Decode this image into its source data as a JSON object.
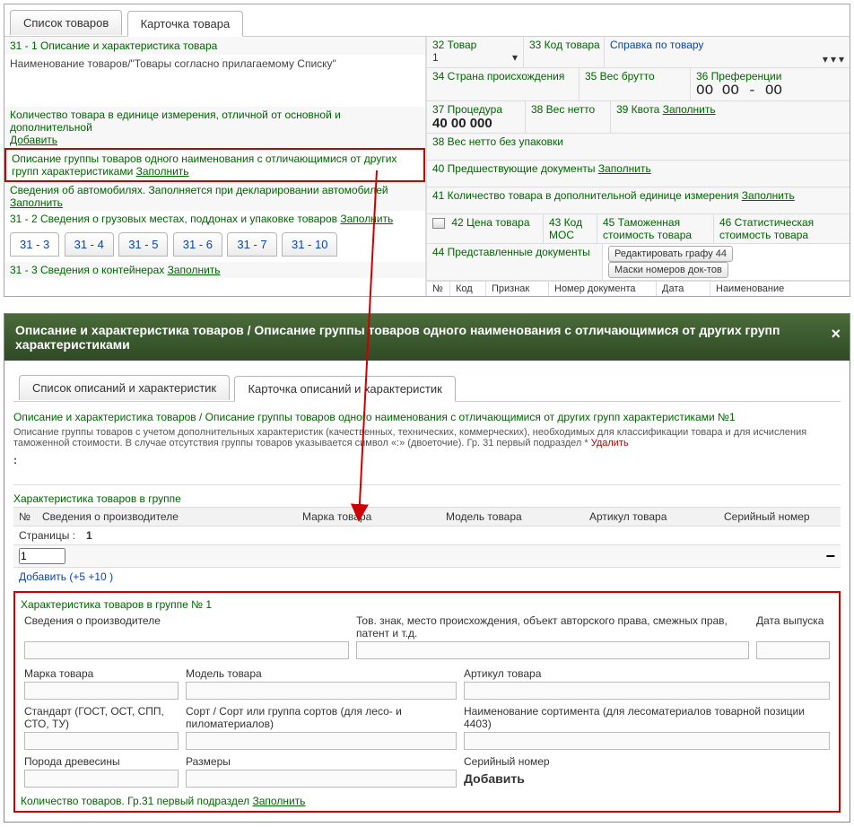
{
  "top": {
    "tabs": {
      "list": "Список товаров",
      "card": "Карточка товара"
    },
    "sec31_1": "31 - 1 Описание и характеристика товара",
    "name_label": "Наименование товаров/\"Товары согласно прилагаемому Списку\"",
    "qty_unit": "Количество товара в единице измерения, отличной от основной и дополнительной",
    "add": "Добавить",
    "group_desc": "Описание группы товаров одного наименования с отличающимися от других групп характеристиками",
    "fill": "Заполнить",
    "autos": "Сведения об автомобилях. Заполняется при декларировании автомобилей",
    "sec31_2": "31 - 2 Сведения о грузовых местах, поддонах и упаковке товаров",
    "mini_tabs": [
      "31 - 3",
      "31 - 4",
      "31 - 5",
      "31 - 6",
      "31 - 7",
      "31 - 10"
    ],
    "sec31_3": "31 - 3 Сведения о контейнерах",
    "right": {
      "c32": "32 Товар",
      "c32v": "1",
      "c33": "33 Код товара",
      "c33help": "Справка по товару",
      "c34": "34 Страна происхождения",
      "c35": "35 Вес брутто",
      "c36": "36 Преференции",
      "c36v": "ОО ОО  -   ОО",
      "c37": "37 Процедура",
      "c37v": "40  00   000",
      "c38": "38 Вес нетто",
      "c39": "39 Квота",
      "c38b": "38 Вес нетто без упаковки",
      "c40": "40 Предшествующие документы",
      "c41": "41 Количество товара в дополнительной единице измерения",
      "c42": "42 Цена товара",
      "c43a": "43 Код МОС",
      "c45": "45 Таможенная стоимость товара",
      "c46": "46 Статистическая стоимость товара",
      "c44": "44 Представленные документы",
      "btn44": "Редактировать графу 44",
      "btnmask": "Маски номеров док-тов",
      "trh": {
        "no": "№",
        "code": "Код",
        "sign": "Признак",
        "docno": "Номер документа",
        "date": "Дата",
        "name": "Наименование"
      }
    }
  },
  "dlg": {
    "title": "Описание и характеристика товаров / Описание группы товаров одного наименования с отличающимися от других групп характеристиками",
    "tabs": {
      "list": "Список описаний и характеристик",
      "card": "Карточка описаний и характеристик"
    },
    "headline": "Описание и характеристика товаров / Описание группы товаров одного наименования с отличающимися от других групп характеристиками №1",
    "note": "Описание группы товаров с учетом дополнительных характеристик (качественных, технических, коммерческих), необходимых для классификации товара и для исчисления таможенной стоимости. В случае отсутствия группы товаров указывается символ «:» (двоеточие). Гр. 31 первый подраздел *",
    "delete": "Удалить",
    "colon": ":",
    "char_group": "Характеристика товаров в группе",
    "tbl": {
      "no": "№",
      "prod": "Сведения о производителе",
      "brand": "Марка товара",
      "model": "Модель товара",
      "art": "Артикул товара",
      "serial": "Серийный номер"
    },
    "pages": "Страницы :",
    "page": "1",
    "rownum": "1",
    "addline": "Добавить  (+5  +10 )",
    "box_title": "Характеристика товаров в группе № 1",
    "f": {
      "prod": "Сведения о производителе",
      "tm": "Тов. знак, место происхождения, объект авторского права, смежных прав, патент и т.д.",
      "date": "Дата выпуска",
      "brand": "Марка товара",
      "model": "Модель товара",
      "art": "Артикул товара",
      "std": "Стандарт (ГОСТ, ОСТ, СПП, СТО, ТУ)",
      "sort": "Сорт / Сорт или группа сортов (для лесо- и пиломатериалов)",
      "sortname": "Наименование сортимента (для лесоматериалов товарной позиции 4403)",
      "wood": "Порода древесины",
      "size": "Размеры",
      "serial": "Серийный номер",
      "add": "Добавить"
    },
    "qty": "Количество товаров. Гр.31 первый подраздел",
    "fill": "Заполнить"
  }
}
